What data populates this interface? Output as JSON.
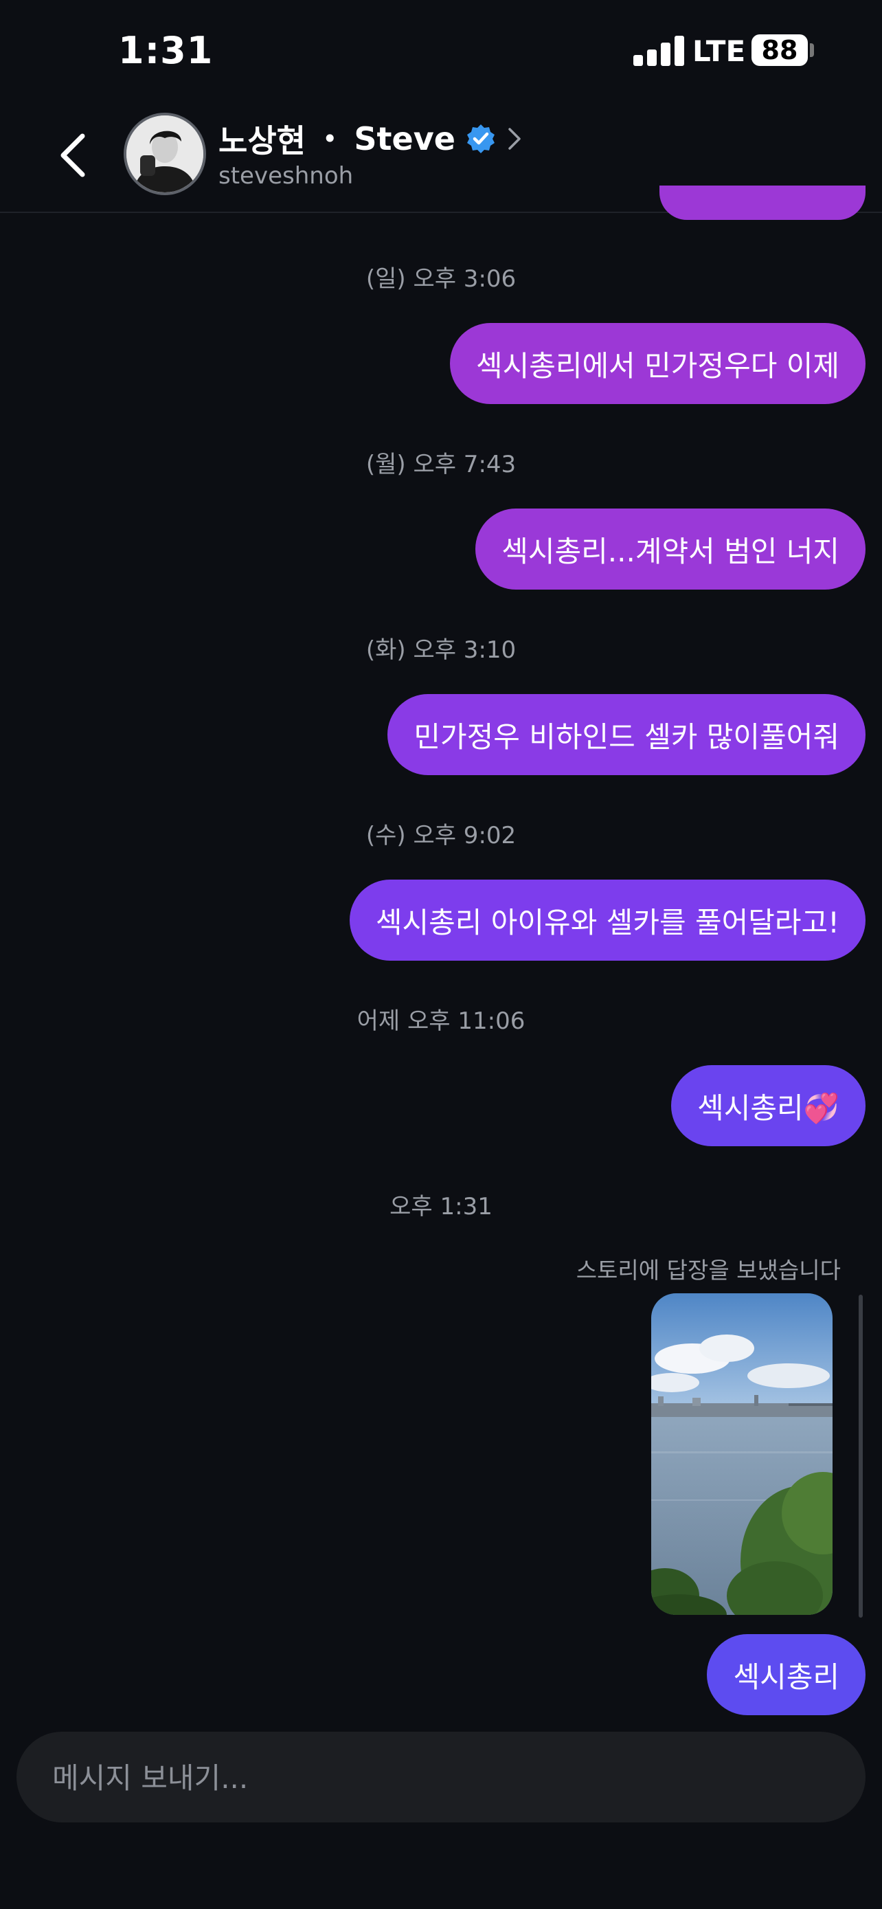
{
  "status_bar": {
    "time": "1:31",
    "network": "LTE",
    "battery": "88"
  },
  "header": {
    "name_korean": "노상현",
    "separator": "•",
    "name_english": "Steve",
    "username": "steveshnoh"
  },
  "colors": {
    "bubble_purple": "#9c38d6",
    "bubble_violet": "#8a3be6",
    "bubble_indigo": "#6a44ef",
    "bubble_blue": "#5d4cf0",
    "verified_blue": "#3897f0"
  },
  "messages": [
    {
      "timestamp": "(일) 오후 3:06",
      "text": "섹시총리에서 민가정우다 이제"
    },
    {
      "timestamp": "(월) 오후 7:43",
      "text": "섹시총리...계약서 범인 너지"
    },
    {
      "timestamp": "(화) 오후 3:10",
      "text": "민가정우 비하인드 셀카 많이풀어줘"
    },
    {
      "timestamp": "(수) 오후 9:02",
      "text": "섹시총리 아이유와 셀카를 풀어달라고!"
    },
    {
      "timestamp": "어제 오후 11:06",
      "text": "섹시총리💞"
    }
  ],
  "latest": {
    "timestamp": "오후 1:31",
    "reply_note": "스토리에 답장을 보냈습니다",
    "story_image": "river-landscape-photo",
    "text": "섹시총리"
  },
  "composer": {
    "placeholder": "메시지 보내기..."
  }
}
